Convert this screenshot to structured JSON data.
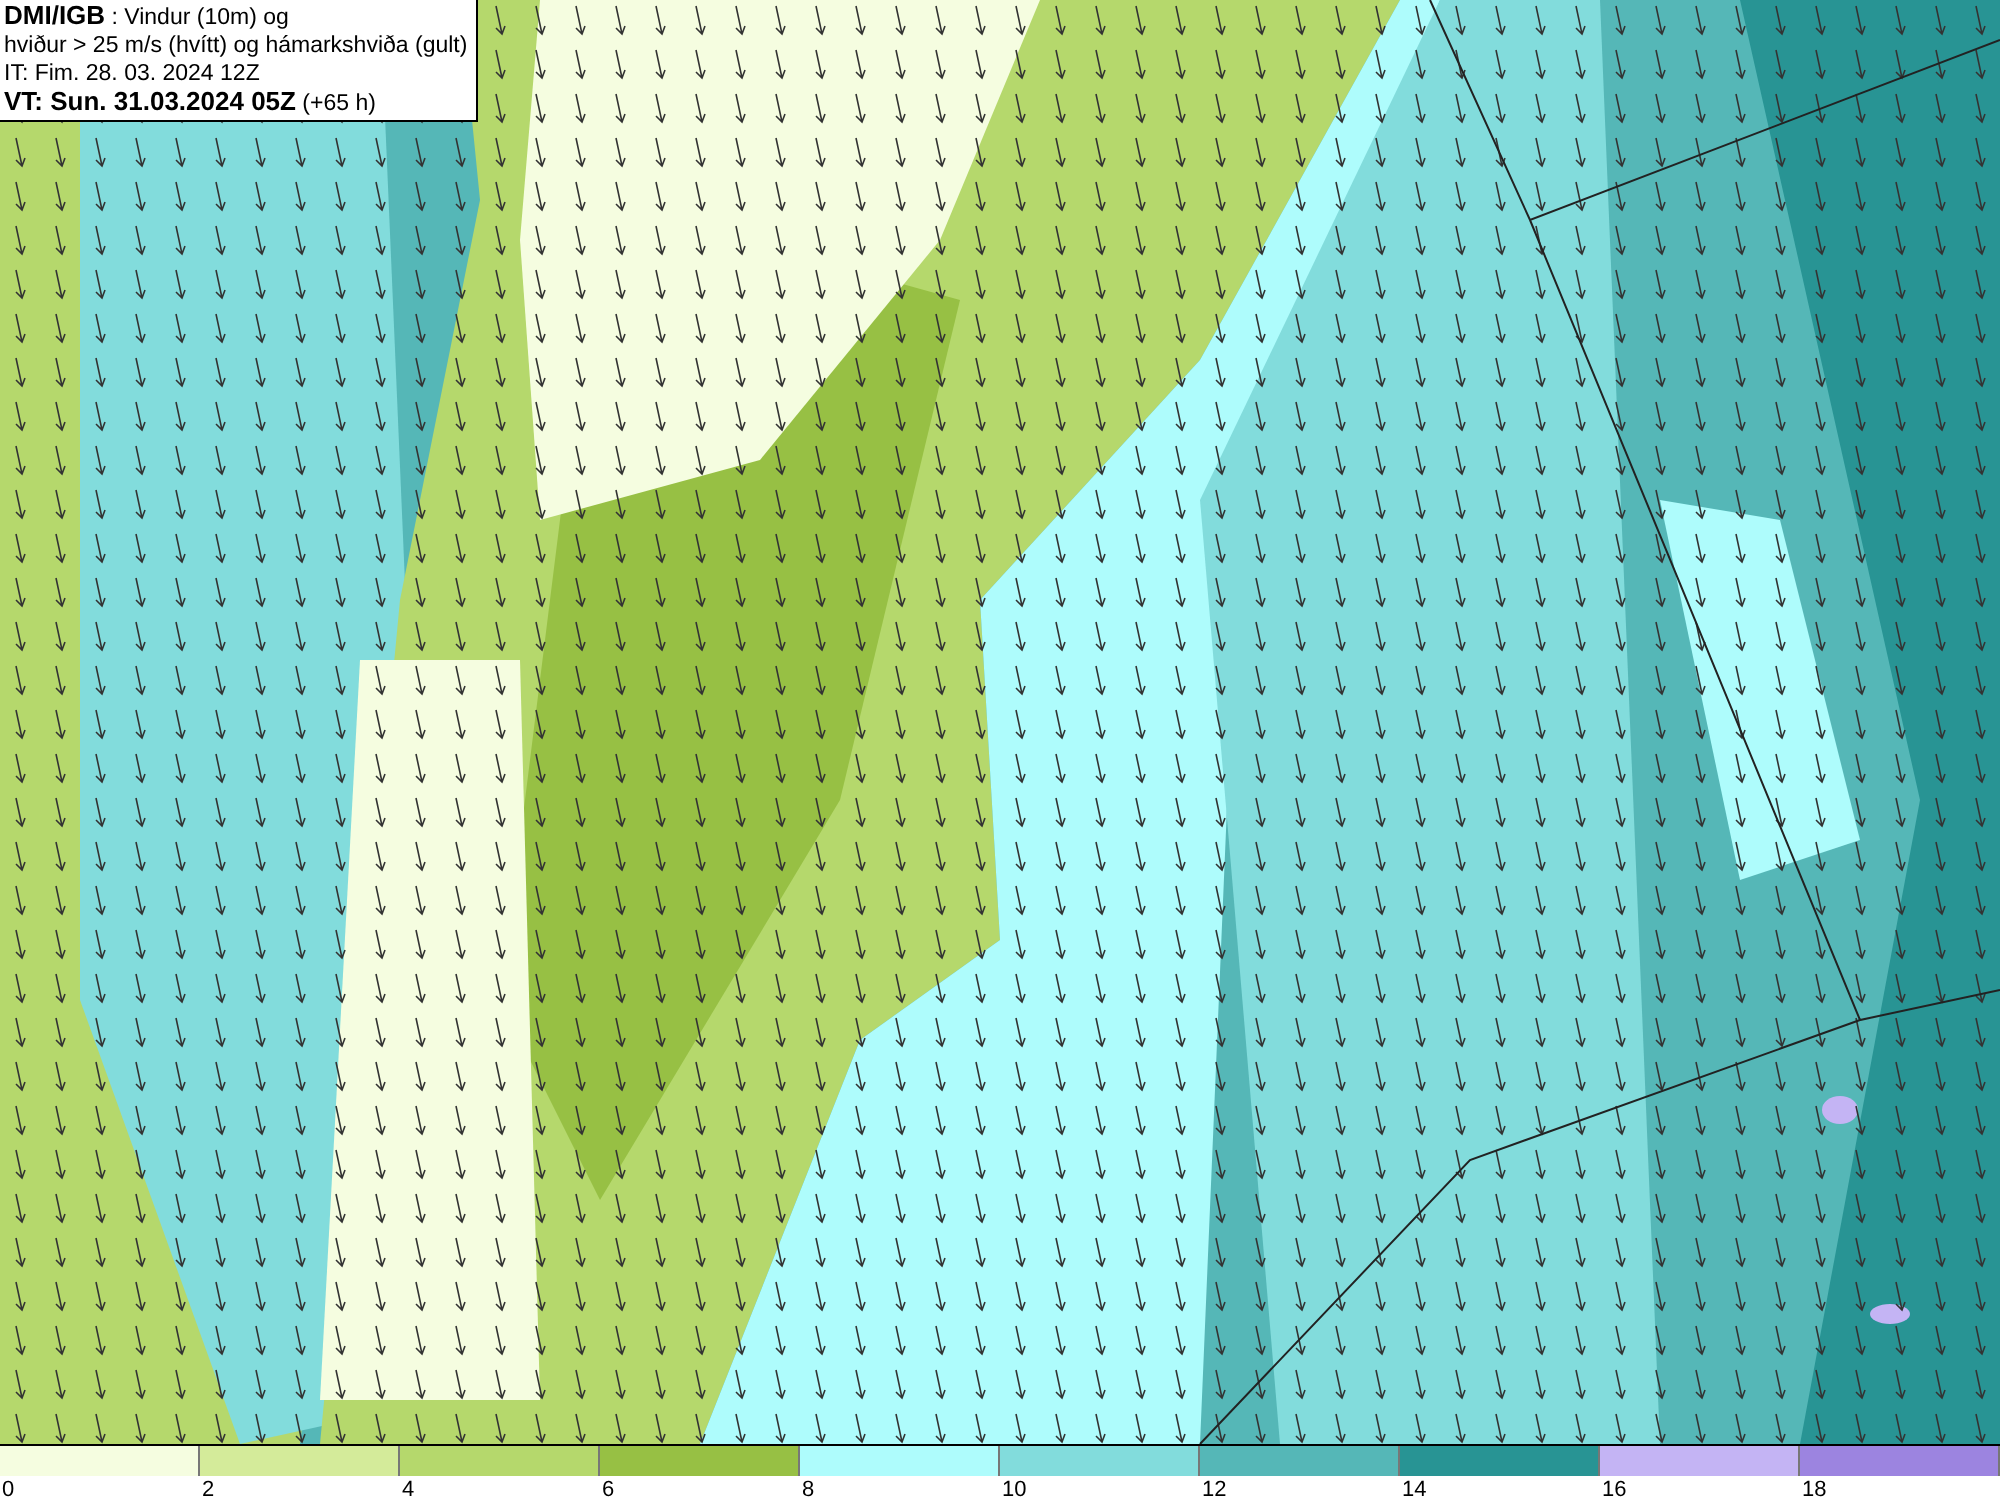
{
  "header": {
    "lines": [
      "**DMI/IGB** : Vindur (10m) og",
      "hviður > 25 m/s (hvítt) og hámarkshviða (gult)",
      "IT: Fim. 28. 03. 2024 12Z",
      "**VT: Sun. 31.03.2024 05Z** (+65 h)"
    ]
  },
  "legend": {
    "items": [
      {
        "label": "0",
        "color": "#f5fde0"
      },
      {
        "label": "2",
        "color": "#d4eb9a"
      },
      {
        "label": "4",
        "color": "#b5d86c"
      },
      {
        "label": "6",
        "color": "#97c044"
      },
      {
        "label": "8",
        "color": "#aefcfc"
      },
      {
        "label": "10",
        "color": "#82dcdc"
      },
      {
        "label": "12",
        "color": "#55b7b7"
      },
      {
        "label": "14",
        "color": "#289494"
      },
      {
        "label": "16",
        "color": "#c4b4f4"
      },
      {
        "label": "18",
        "color": "#9c84e0"
      }
    ]
  }
}
